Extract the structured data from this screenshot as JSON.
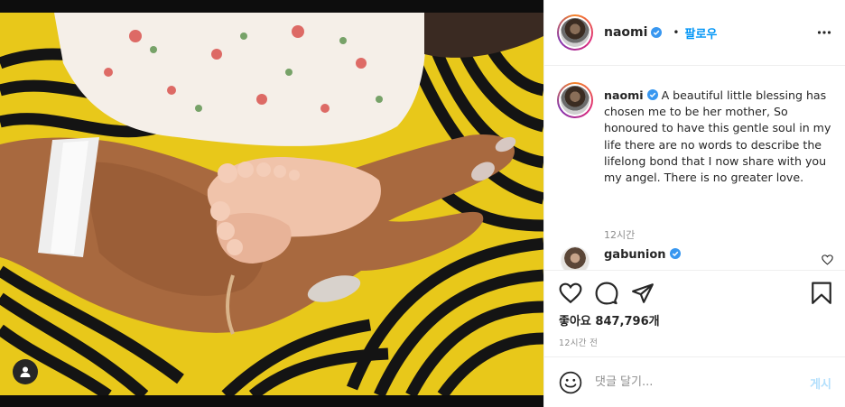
{
  "post": {
    "username": "naomi",
    "follow_label": "팔로우",
    "separator": "•",
    "caption_username": "naomi",
    "caption_text": " A beautiful little blessing has chosen me to be her mother, So honoured to have this gentle soul in my life there are no words to describe the lifelong bond that I now share with you my angel. There is no greater love.",
    "caption_time": "12시간",
    "likes_label": "좋아요 847,796개",
    "post_time": "12시간 전"
  },
  "comments": [
    {
      "username": "gabunion"
    }
  ],
  "add_comment": {
    "placeholder": "댓글 달기...",
    "post_label": "게시"
  },
  "icons": {
    "verified": "verified-badge-icon",
    "more": "more-options-icon",
    "like": "heart-icon",
    "comment": "comment-bubble-icon",
    "share": "paper-plane-icon",
    "save": "bookmark-icon",
    "emoji": "smiley-icon",
    "user_tag": "person-icon"
  },
  "colors": {
    "accent": "#0095f6",
    "verified": "#3897f0",
    "text": "#262626",
    "secondary_text": "#8e8e8e",
    "post_disabled": "#b2dffc"
  }
}
